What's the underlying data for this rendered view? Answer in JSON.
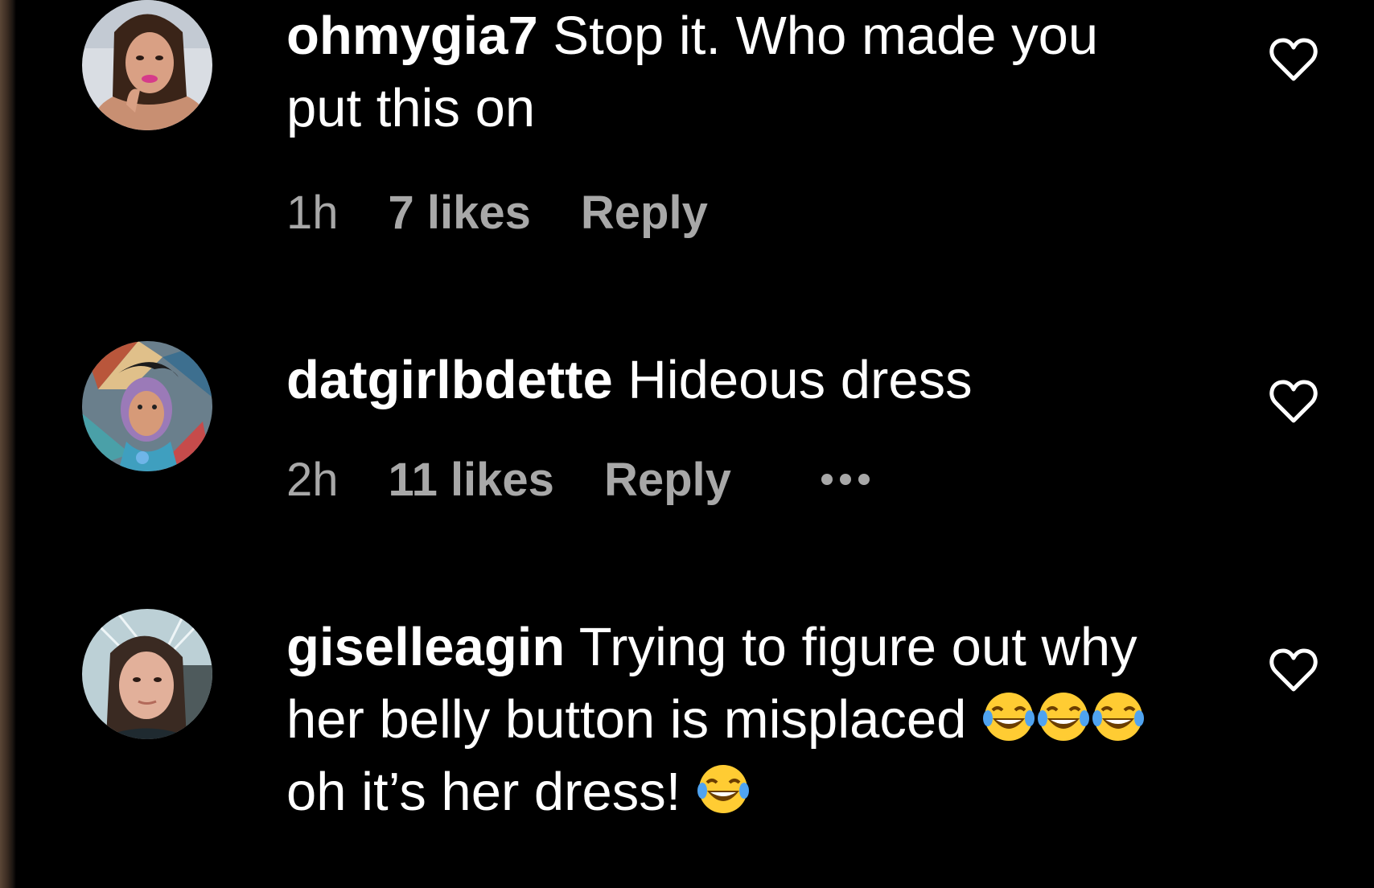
{
  "colors": {
    "background": "#000000",
    "text_primary": "#ffffff",
    "text_secondary": "#a8a8a8"
  },
  "comments": [
    {
      "username": "ohmygia7",
      "text": "Stop it. Who made you put this on",
      "time": "1h",
      "likes": "7 likes",
      "reply": "Reply",
      "avatar": "avatar-photo",
      "like_icon": "heart-outline-icon"
    },
    {
      "username": "datgirlbdette",
      "text": "Hideous dress",
      "time": "2h",
      "likes": "11 likes",
      "reply": "Reply",
      "avatar": "avatar-artwork",
      "like_icon": "heart-outline-icon",
      "more_icon": "more-options-icon"
    },
    {
      "username": "giselleagin",
      "text_part1": "Trying to figure out why her belly button is misplaced",
      "emoji_run": "😂😂😂",
      "text_part2": "oh it’s her dress!",
      "emoji_end": "😂",
      "avatar": "avatar-photo",
      "like_icon": "heart-outline-icon"
    }
  ]
}
